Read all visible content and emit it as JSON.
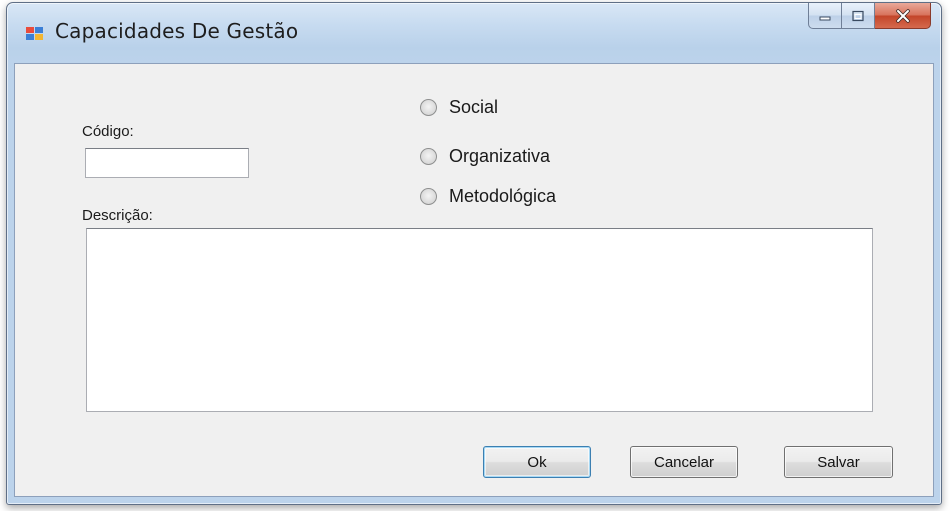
{
  "window": {
    "title": "Capacidades De Gestão",
    "icon": "winforms-app-icon",
    "caption_buttons": [
      "minimize-icon",
      "maximize-icon",
      "close-icon"
    ]
  },
  "form": {
    "codigo_label": "Código:",
    "codigo_value": "",
    "descricao_label": "Descrição:",
    "descricao_value": "",
    "radios": [
      {
        "label": "Social",
        "checked": false
      },
      {
        "label": "Organizativa",
        "checked": false
      },
      {
        "label": "Metodológica",
        "checked": false
      }
    ]
  },
  "buttons": {
    "ok": "Ok",
    "cancelar": "Cancelar",
    "salvar": "Salvar"
  }
}
